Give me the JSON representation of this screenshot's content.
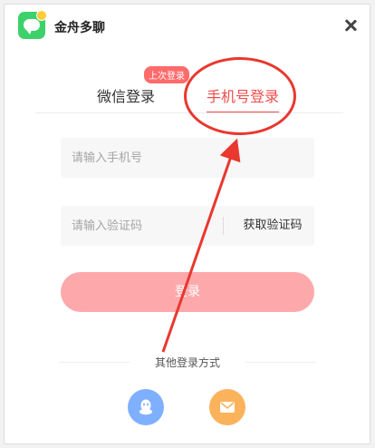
{
  "app": {
    "title": "金舟多聊"
  },
  "icons": {
    "close": "close-icon",
    "qq": "qq-icon",
    "mail": "mail-icon"
  },
  "tabs": [
    {
      "label": "微信登录",
      "active": false
    },
    {
      "label": "手机号登录",
      "active": true
    }
  ],
  "badge": {
    "last_login": "上次登录"
  },
  "form": {
    "phone": {
      "placeholder": "请输入手机号",
      "value": ""
    },
    "code": {
      "placeholder": "请输入验证码",
      "value": ""
    },
    "get_code_label": "获取验证码",
    "login_label": "登录"
  },
  "other_login": {
    "label": "其他登录方式"
  },
  "colors": {
    "accent": "#f04b4b",
    "login_button": "#fda9ab",
    "qq": "#7fb0ff",
    "mail": "#fbb35b",
    "annotation": "#e8382f"
  }
}
